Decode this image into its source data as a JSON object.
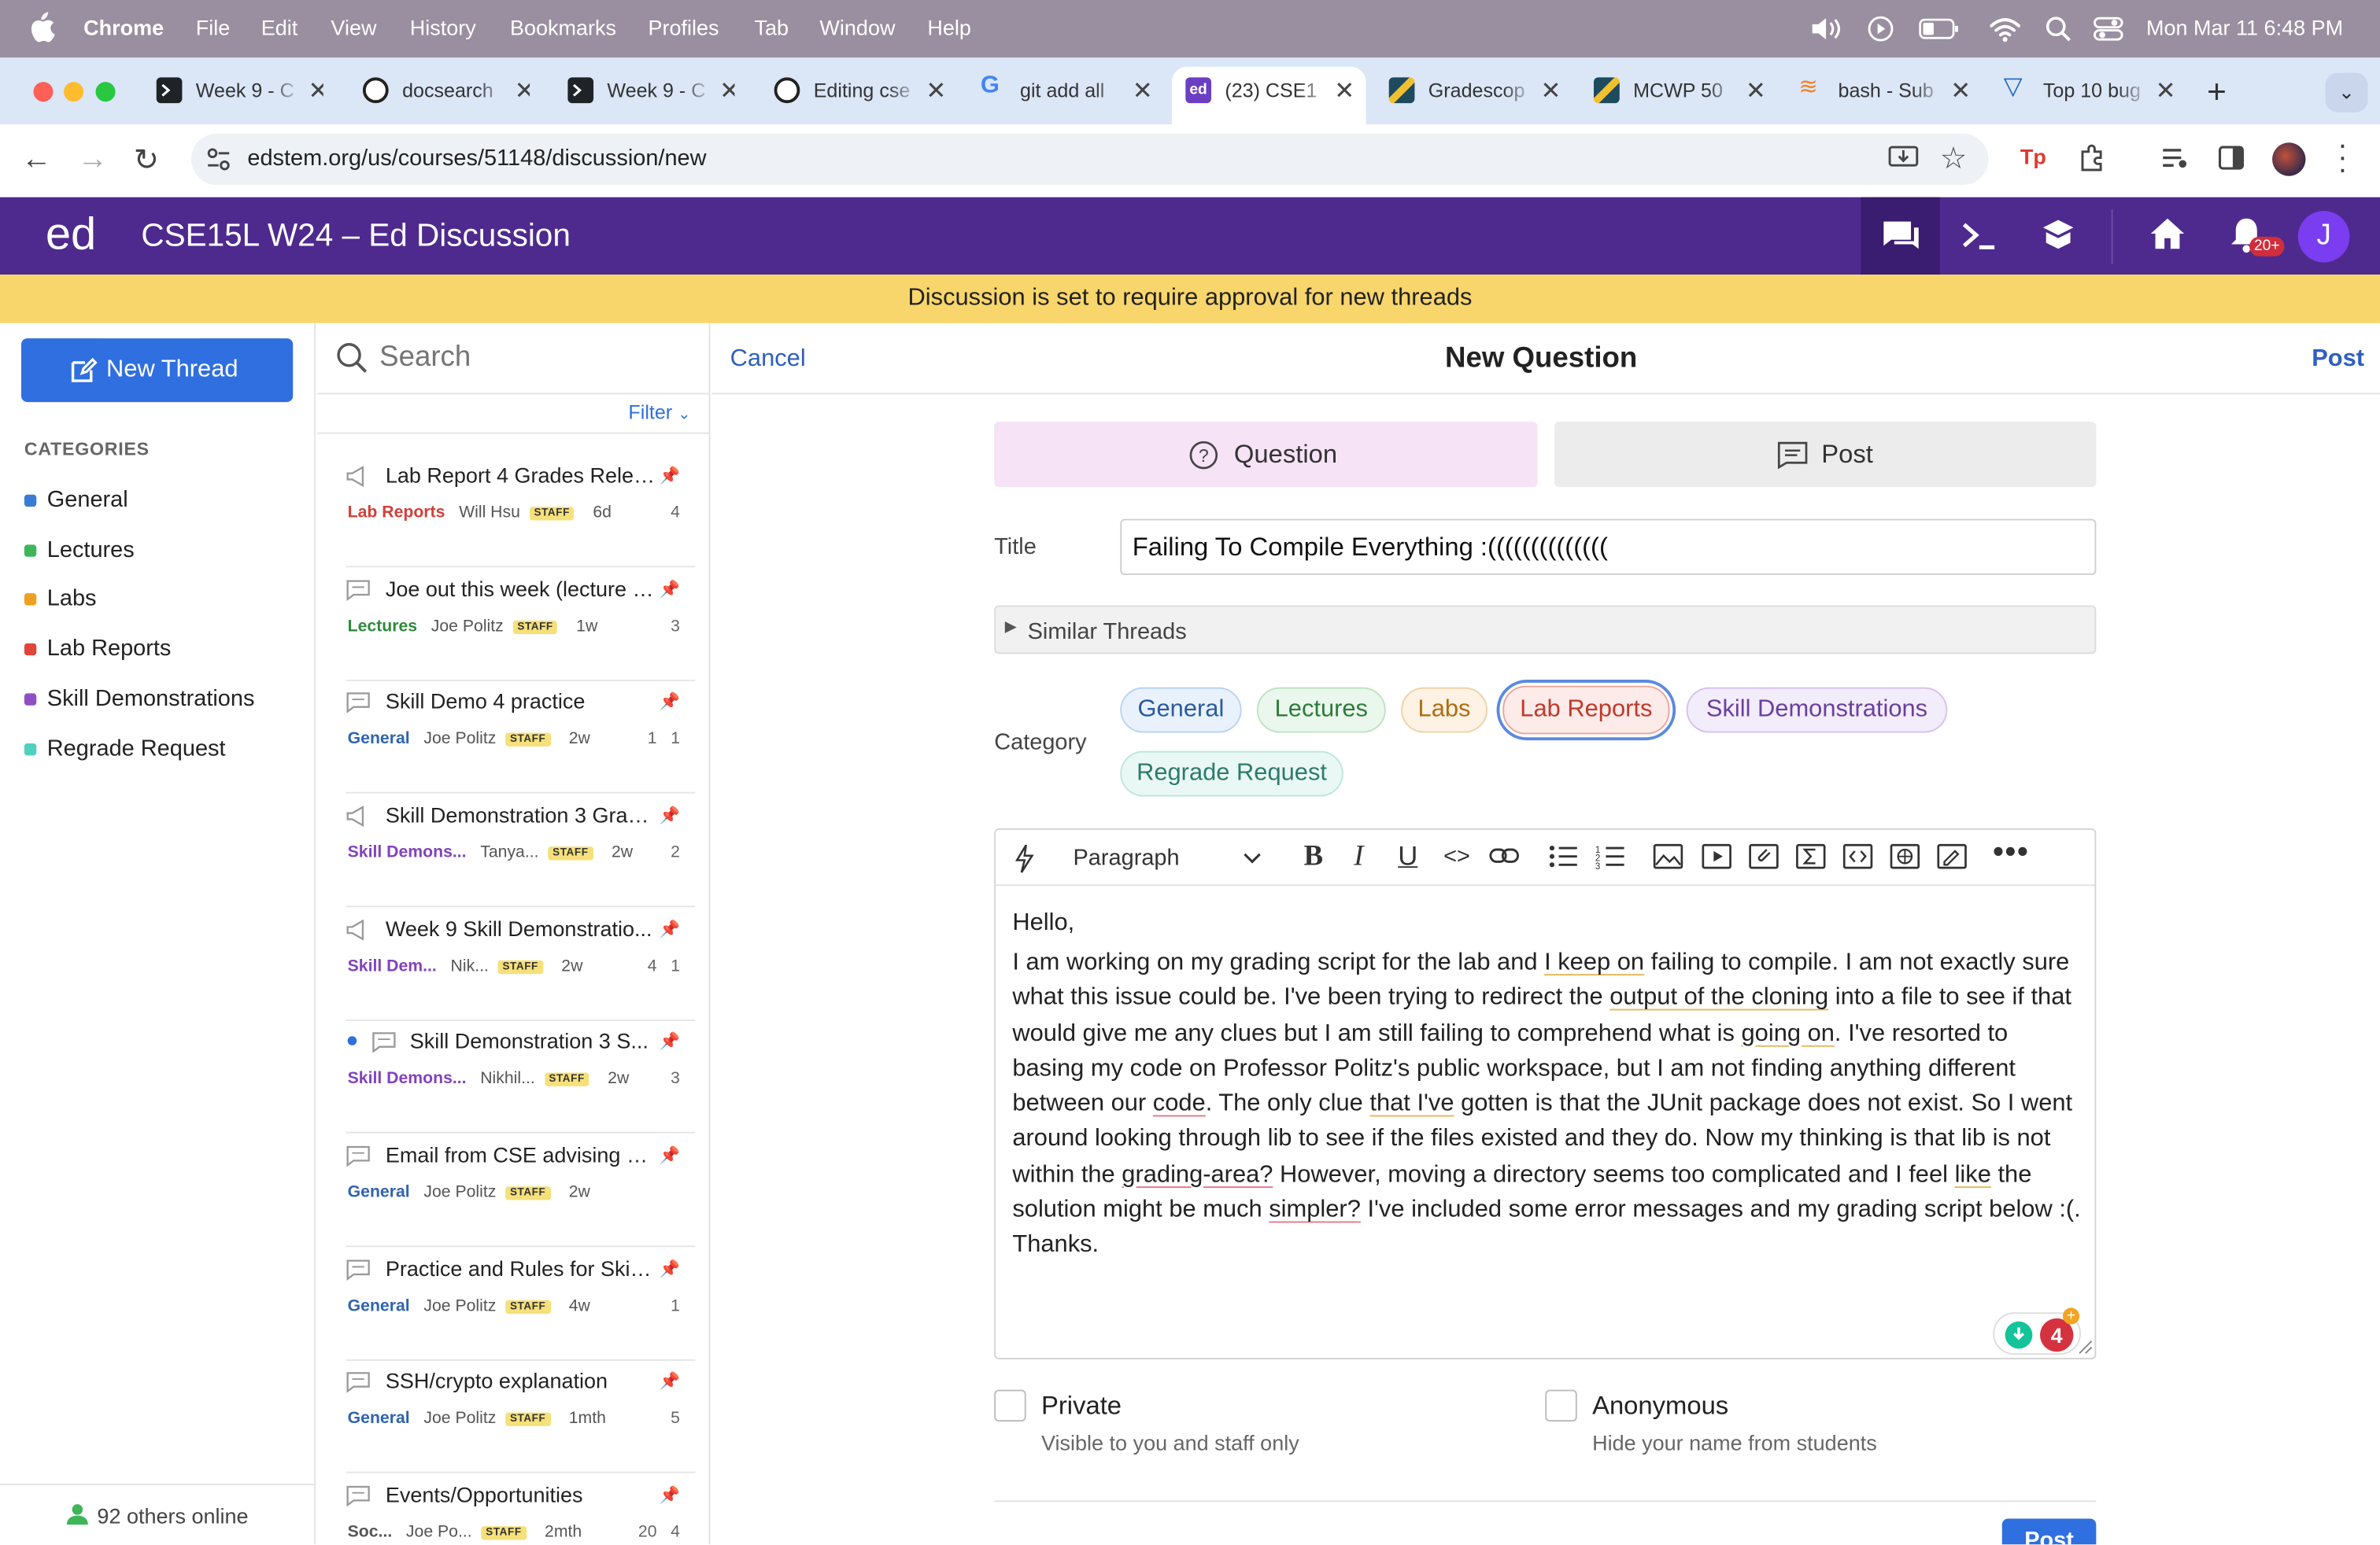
{
  "mac_menubar": {
    "app": "Chrome",
    "items": [
      "File",
      "Edit",
      "View",
      "History",
      "Bookmarks",
      "Profiles",
      "Tab",
      "Window",
      "Help"
    ],
    "clock": "Mon Mar 11  6:48 PM"
  },
  "browser": {
    "tabs": [
      {
        "title": "Week 9 - C",
        "icon": "terminal-icon"
      },
      {
        "title": "docsearch",
        "icon": "github-icon"
      },
      {
        "title": "Week 9 - C",
        "icon": "terminal-icon"
      },
      {
        "title": "Editing cse",
        "icon": "github-icon"
      },
      {
        "title": "git add all",
        "icon": "google-icon"
      },
      {
        "title": "(23) CSE1",
        "icon": "ed-icon",
        "active": true
      },
      {
        "title": "Gradescop",
        "icon": "gradescope-icon"
      },
      {
        "title": "MCWP 50",
        "icon": "gradescope-icon"
      },
      {
        "title": "bash - Sub",
        "icon": "stackoverflow-icon"
      },
      {
        "title": "Top 10 bug",
        "icon": "vuetify-icon"
      }
    ],
    "url": "edstem.org/us/courses/51148/discussion/new"
  },
  "ed": {
    "logo": "ed",
    "course_title": "CSE15L W24 – Ed Discussion",
    "notification_count": "20+",
    "avatar_initial": "J",
    "banner": "Discussion is set to require approval for new threads"
  },
  "sidebar": {
    "new_thread_label": "New Thread",
    "categories_heading": "CATEGORIES",
    "categories": [
      {
        "label": "General",
        "color": "#3a7bd5"
      },
      {
        "label": "Lectures",
        "color": "#3fb55a"
      },
      {
        "label": "Labs",
        "color": "#f0a020"
      },
      {
        "label": "Lab Reports",
        "color": "#e0453a"
      },
      {
        "label": "Skill Demonstrations",
        "color": "#8e4fc4"
      },
      {
        "label": "Regrade Request",
        "color": "#4fd0c0"
      }
    ],
    "online_text": "92 others online"
  },
  "thread_list": {
    "search_placeholder": "Search",
    "filter_label": "Filter",
    "threads": [
      {
        "title": "Lab Report 4 Grades Relea...",
        "category": "Lab Reports",
        "cat_color": "#d0403a",
        "author": "Will Hsu",
        "age": "6d",
        "stats": "4"
      },
      {
        "title": "Joe out this week (lecture s...",
        "category": "Lectures",
        "cat_color": "#2e8a3c",
        "author": "Joe Politz",
        "age": "1w",
        "stats": "3"
      },
      {
        "title": "Skill Demo 4 practice",
        "category": "General",
        "cat_color": "#2f64b0",
        "author": "Joe Politz",
        "age": "2w",
        "stats": "1   1"
      },
      {
        "title": "Skill Demonstration 3 Grad...",
        "category": "Skill Demons...",
        "cat_color": "#8242bd",
        "author": "Tanya...",
        "age": "2w",
        "stats": "2"
      },
      {
        "title": "Week 9 Skill Demonstratio...",
        "category": "Skill Dem...",
        "cat_color": "#8242bd",
        "author": "Nik...",
        "age": "2w",
        "stats": "4   1"
      },
      {
        "title": "Skill Demonstration 3 S...",
        "category": "Skill Demons...",
        "cat_color": "#8242bd",
        "author": "Nikhil...",
        "age": "2w",
        "stats": "3"
      },
      {
        "title": "Email from CSE advising a...",
        "category": "General",
        "cat_color": "#2f64b0",
        "author": "Joe Politz",
        "age": "2w",
        "stats": ""
      },
      {
        "title": "Practice and Rules for Skill ...",
        "category": "General",
        "cat_color": "#2f64b0",
        "author": "Joe Politz",
        "age": "4w",
        "stats": "1"
      },
      {
        "title": "SSH/crypto explanation",
        "category": "General",
        "cat_color": "#2f64b0",
        "author": "Joe Politz",
        "age": "1mth",
        "stats": "5"
      },
      {
        "title": "Events/Opportunities",
        "category": "Soc...",
        "cat_color": "#555555",
        "author": "Joe Po...",
        "age": "2mth",
        "stats": "20   4"
      }
    ],
    "staff_badge": "STAFF"
  },
  "composer": {
    "cancel_label": "Cancel",
    "heading": "New Question",
    "post_label": "Post",
    "type_question": "Question",
    "type_post": "Post",
    "title_label": "Title",
    "title_value": "Failing To Compile Everything :((((((((((((((",
    "similar_threads": "Similar Threads",
    "category_label": "Category",
    "categories": [
      "General",
      "Lectures",
      "Labs",
      "Lab Reports",
      "Skill Demonstrations",
      "Regrade Request"
    ],
    "selected_category": "Lab Reports",
    "paragraph_style": "Paragraph",
    "body_greeting": "Hello,",
    "body": [
      {
        "t": "I am working on my grading script for the lab and "
      },
      {
        "t": "I keep on",
        "u": "y"
      },
      {
        "t": " failing to compile. I am not exactly sure what this issue could be. I've been trying to redirect the "
      },
      {
        "t": "output of the cloning",
        "u": "y"
      },
      {
        "t": " into a file to see if that would give me any clues but I am still failing to comprehend what is "
      },
      {
        "t": "going on",
        "u": "y"
      },
      {
        "t": ". I've resorted to basing my code on Professor Politz's public workspace, but I am not finding anything different between our "
      },
      {
        "t": "code",
        "u": "r"
      },
      {
        "t": ". The only clue "
      },
      {
        "t": "that I've",
        "u": "y"
      },
      {
        "t": " gotten is that the JUnit package does not exist. So I went around looking through lib to see if the files existed and they do. Now my thinking is that lib is not within the "
      },
      {
        "t": "grading-area?",
        "u": "r"
      },
      {
        "t": " However, moving a directory seems too complicated and I feel "
      },
      {
        "t": "like",
        "u": "y"
      },
      {
        "t": " the solution might be much "
      },
      {
        "t": "simpler?",
        "u": "r"
      },
      {
        "t": " I've included some error messages and my grading script below :(. Thanks."
      }
    ],
    "grammar_badge": "4",
    "private_label": "Private",
    "private_hint": "Visible to you and staff only",
    "anonymous_label": "Anonymous",
    "anonymous_hint": "Hide your name from students",
    "bottom_post_label": "Post"
  }
}
